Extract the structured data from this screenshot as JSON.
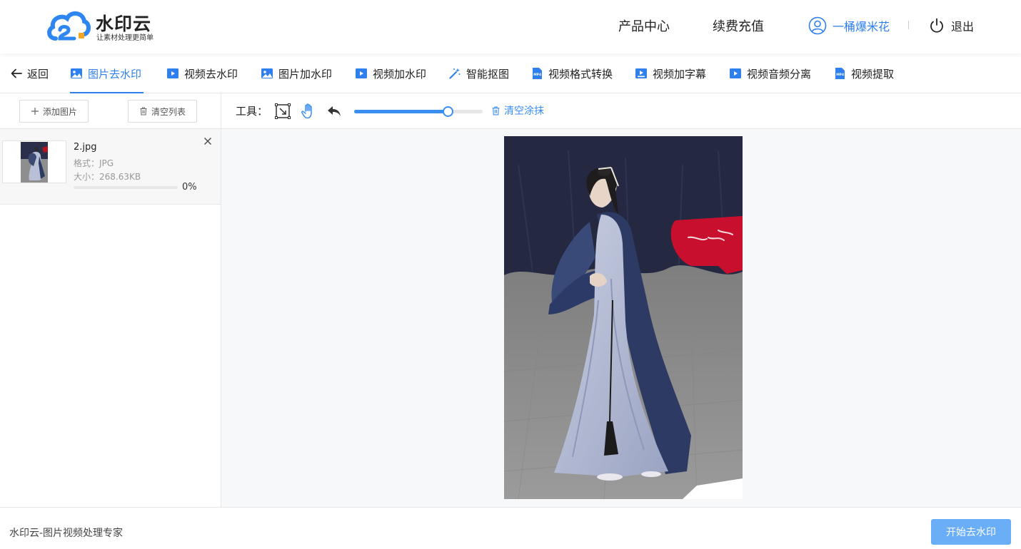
{
  "header": {
    "logo_title": "水印云",
    "logo_slogan": "让素材处理更简单",
    "nav": {
      "products": "产品中心",
      "renew": "续费充值",
      "username": "一桶爆米花",
      "logout": "退出"
    },
    "icons": {
      "avatar": "user-circle-icon",
      "logout": "power-icon"
    }
  },
  "tabs": {
    "back": "返回",
    "items": [
      {
        "label": "图片去水印",
        "icon": "image-icon",
        "active": true
      },
      {
        "label": "视频去水印",
        "icon": "video-icon",
        "active": false
      },
      {
        "label": "图片加水印",
        "icon": "image-add-icon",
        "active": false
      },
      {
        "label": "视频加水印",
        "icon": "video-add-icon",
        "active": false
      },
      {
        "label": "智能抠图",
        "icon": "magic-wand-icon",
        "active": false
      },
      {
        "label": "视频格式转换",
        "icon": "mp4-file-icon",
        "active": false
      },
      {
        "label": "视频加字幕",
        "icon": "video-subtitle-icon",
        "active": false
      },
      {
        "label": "视频音频分离",
        "icon": "video-audio-icon",
        "active": false
      },
      {
        "label": "视频提取",
        "icon": "mp4-extract-icon",
        "active": false
      }
    ]
  },
  "sidebar": {
    "add_label": "添加图片",
    "clear_label": "清空列表",
    "files": [
      {
        "name": "2.jpg",
        "format": "格式：JPG",
        "size": "大小：268.63KB",
        "progress_text": "0%",
        "progress": 0
      }
    ]
  },
  "toolbar": {
    "label": "工具：",
    "icons": [
      "select-area-icon",
      "hand-pan-icon",
      "undo-icon"
    ],
    "brush_size_fraction": 0.73,
    "clear_label": "清空涂抹"
  },
  "footer": {
    "text": "水印云-图片视频处理专家",
    "start_label": "开始去水印"
  },
  "colors": {
    "accent": "#2f80ed",
    "start_button": "#6aaef8",
    "watermark_badge": "#c8102e"
  }
}
